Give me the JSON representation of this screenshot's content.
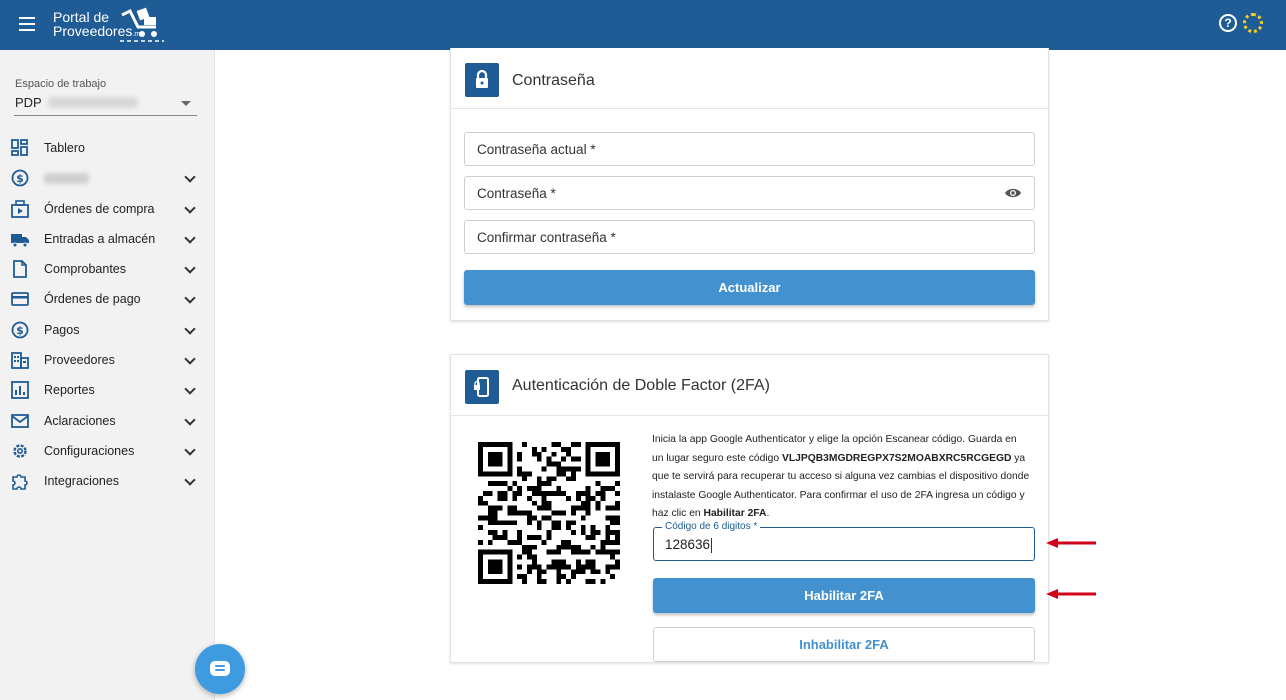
{
  "header": {
    "logo_line1": "Portal de",
    "logo_line2": "Proveedores",
    "logo_suffix": ".mx",
    "help_glyph": "?",
    "colors": {
      "bar": "#1f5c96",
      "accent": "#4392cf"
    }
  },
  "sidebar": {
    "workspace_label": "Espacio de trabajo",
    "workspace_value": "PDP",
    "items": [
      {
        "label": "Tablero",
        "icon": "dashboard-icon",
        "chevron": false
      },
      {
        "label": "",
        "icon": "dollar-circle-icon",
        "chevron": true,
        "blurred": true
      },
      {
        "label": "Órdenes de compra",
        "icon": "purchase-order-icon",
        "chevron": true
      },
      {
        "label": "Entradas a almacén",
        "icon": "truck-icon",
        "chevron": true
      },
      {
        "label": "Comprobantes",
        "icon": "document-icon",
        "chevron": true
      },
      {
        "label": "Órdenes de pago",
        "icon": "credit-card-icon",
        "chevron": true
      },
      {
        "label": "Pagos",
        "icon": "dollar-circle-icon",
        "chevron": true
      },
      {
        "label": "Proveedores",
        "icon": "building-icon",
        "chevron": true
      },
      {
        "label": "Reportes",
        "icon": "bar-chart-icon",
        "chevron": true
      },
      {
        "label": "Aclaraciones",
        "icon": "mail-icon",
        "chevron": true
      },
      {
        "label": "Configuraciones",
        "icon": "gear-icon",
        "chevron": true
      },
      {
        "label": "Integraciones",
        "icon": "puzzle-icon",
        "chevron": true
      }
    ]
  },
  "password_card": {
    "title": "Contraseña",
    "current_label": "Contraseña actual *",
    "new_label": "Contraseña *",
    "confirm_label": "Confirmar contraseña *",
    "update_button": "Actualizar"
  },
  "twofa_card": {
    "title": "Autenticación de Doble Factor (2FA)",
    "instr_part1": "Inicia la app Google Authenticator y elige la opción Escanear código. Guarda en un lugar seguro este código ",
    "secret_code": "VLJPQB3MGDREGPX7S2MOABXRC5RCGEGD",
    "instr_part2": " ya que te servirá para recuperar tu acceso si alguna vez cambias el dispositivo donde instalaste Google Authenticator. Para confirmar el uso de 2FA ingresa un código y haz clic en ",
    "instr_bold_action": "Habilitar 2FA",
    "instr_end": ".",
    "code_label": "Código de 6 digitos *",
    "code_value": "128636",
    "enable_button": "Habilitar 2FA",
    "disable_button": "Inhabilitar 2FA"
  },
  "annotations": {
    "arrow_color": "#d0021b"
  }
}
